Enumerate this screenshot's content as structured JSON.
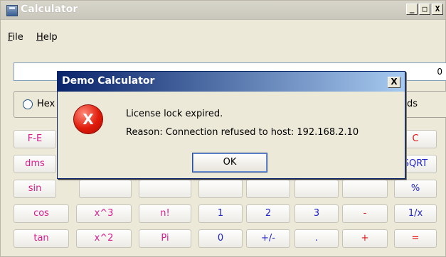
{
  "window": {
    "title": "Calculator",
    "buttons": [
      "_",
      "□",
      "X"
    ]
  },
  "menu": [
    {
      "label": "File",
      "mnemonic": "F",
      "rest": "ile"
    },
    {
      "label": "Help",
      "mnemonic": "H",
      "rest": "elp"
    }
  ],
  "display": {
    "value": "0"
  },
  "mode": {
    "left_label": "Hex",
    "right_label": "ds"
  },
  "keys": [
    [
      {
        "label": "F-E",
        "color": "pink"
      },
      {
        "label": "C",
        "color": "red"
      }
    ],
    [
      {
        "label": "dms",
        "color": "pink"
      },
      {
        "label": "SQRT",
        "color": "blue"
      }
    ],
    [
      {
        "label": "sin",
        "color": "pink"
      },
      {
        "label": "%",
        "color": "blue"
      }
    ],
    [
      {
        "label": "cos",
        "color": "pink"
      },
      {
        "label": "x^3",
        "color": "pink"
      },
      {
        "label": "n!",
        "color": "pink"
      },
      {
        "label": "1",
        "color": "blue"
      },
      {
        "label": "2",
        "color": "blue"
      },
      {
        "label": "3",
        "color": "blue"
      },
      {
        "label": "-",
        "color": "red"
      },
      {
        "label": "1/x",
        "color": "blue"
      }
    ],
    [
      {
        "label": "tan",
        "color": "pink"
      },
      {
        "label": "x^2",
        "color": "pink"
      },
      {
        "label": "Pi",
        "color": "pink"
      },
      {
        "label": "0",
        "color": "blue"
      },
      {
        "label": "+/-",
        "color": "blue"
      },
      {
        "label": ".",
        "color": "blue"
      },
      {
        "label": "+",
        "color": "red"
      },
      {
        "label": "=",
        "color": "red"
      }
    ]
  ],
  "dialog": {
    "title": "Demo Calculator",
    "close_label": "X",
    "icon": "error-x-icon",
    "icon_glyph": "X",
    "message_line1": "License lock expired.",
    "message_line2": "Reason: Connection refused to host: 192.168.2.10",
    "ok_label": "OK"
  }
}
